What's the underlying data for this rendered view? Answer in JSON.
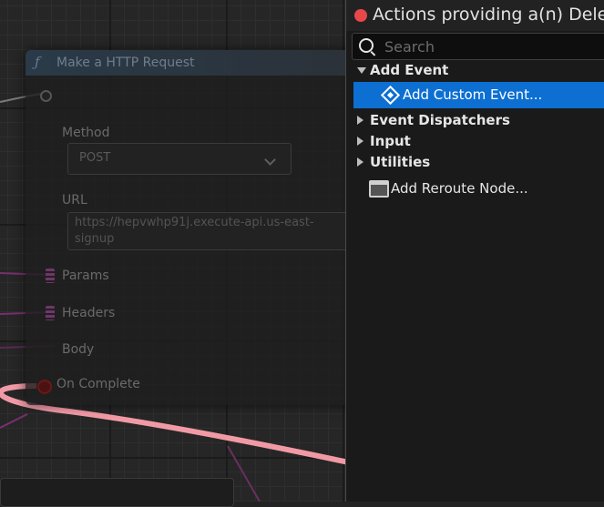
{
  "node": {
    "title": "Make a HTTP Request",
    "method_label": "Method",
    "method_value": "POST",
    "url_label": "URL",
    "url_line1": "https://hepvwhp91j.execute-api.us-east-",
    "url_line2": "signup",
    "params_label": "Params",
    "headers_label": "Headers",
    "body_label": "Body",
    "on_complete_label": "On Complete"
  },
  "panel": {
    "title": "Actions providing a(n) Deleg",
    "search_placeholder": "Search",
    "add_event": "Add Event",
    "add_custom_event": "Add Custom Event...",
    "event_dispatchers": "Event Dispatchers",
    "input": "Input",
    "utilities": "Utilities",
    "add_reroute_node": "Add Reroute Node..."
  },
  "colors": {
    "highlight": "#0d6fd2",
    "close": "#e8484a",
    "wire": "#f19aa6"
  }
}
